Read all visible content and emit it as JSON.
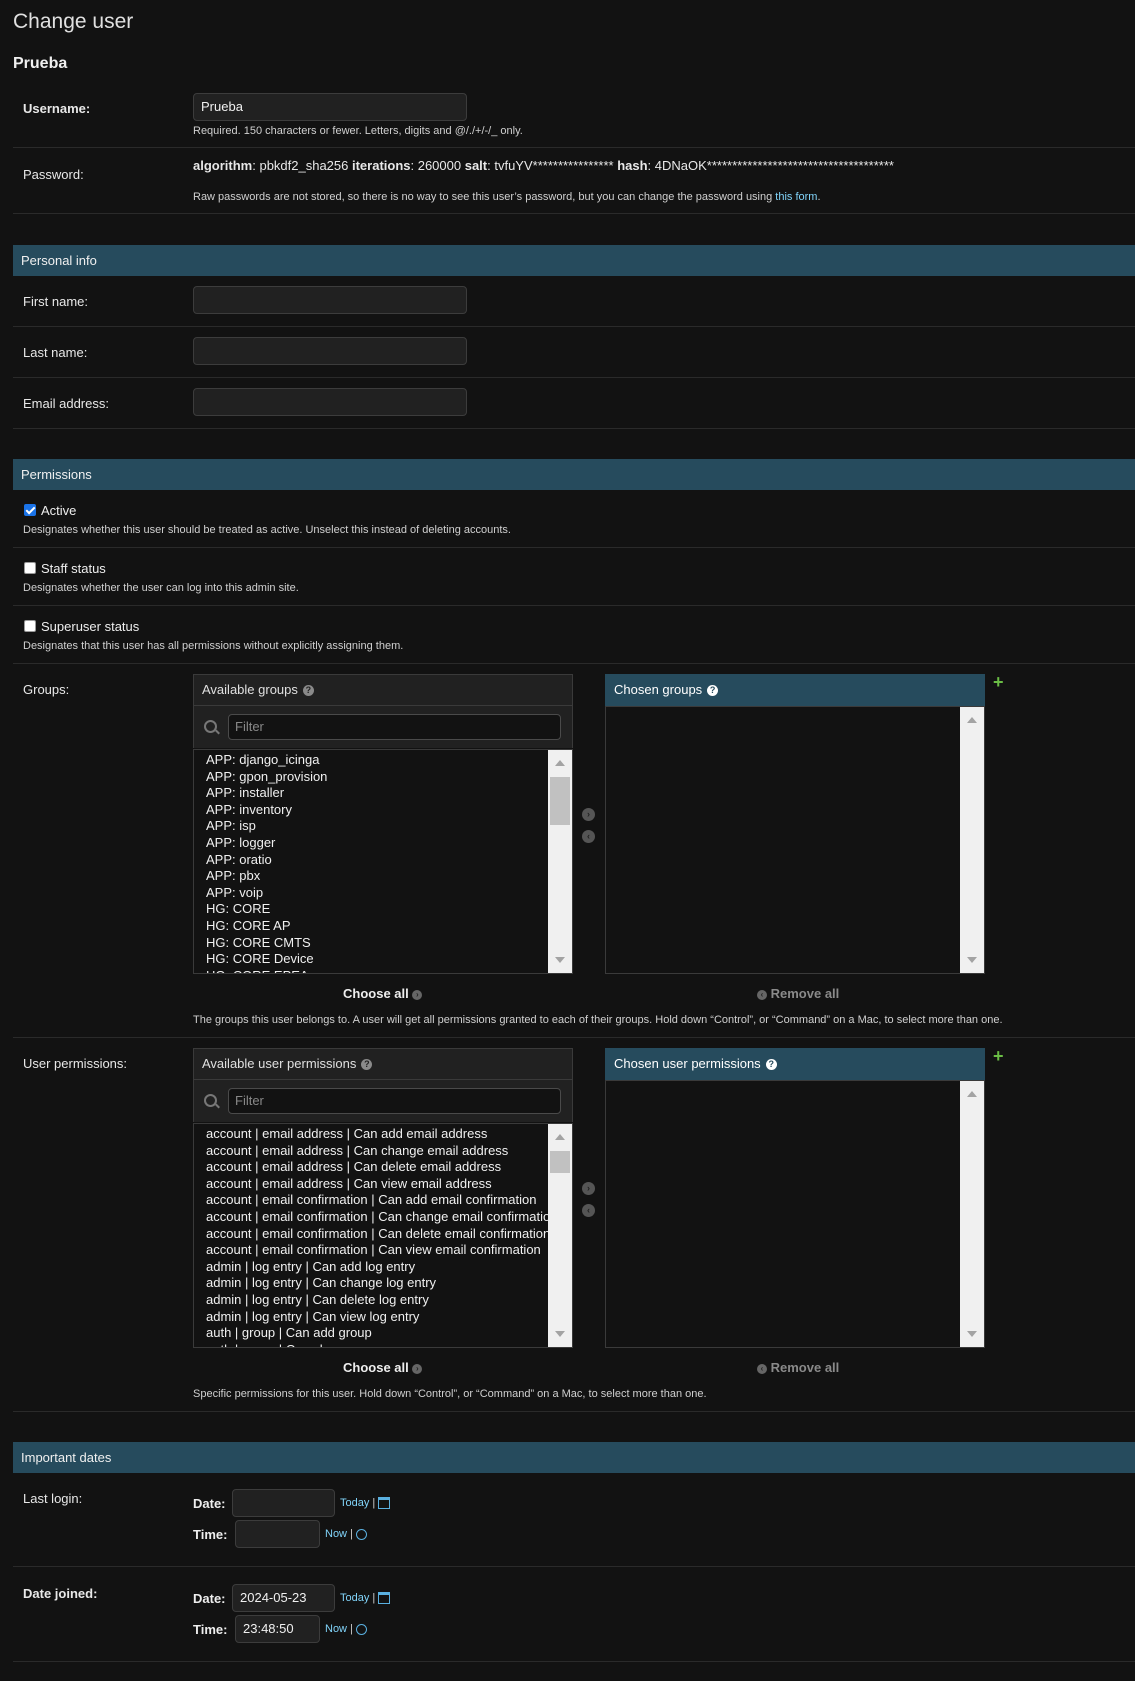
{
  "page": {
    "title": "Change user",
    "subtitle": "Prueba"
  },
  "username": {
    "label": "Username:",
    "value": "Prueba",
    "help": "Required. 150 characters or fewer. Letters, digits and @/./+/-/_ only."
  },
  "password": {
    "label": "Password:",
    "algorithm_label": "algorithm",
    "algorithm_value": ": pbkdf2_sha256 ",
    "iterations_label": "iterations",
    "iterations_value": ": 260000 ",
    "salt_label": "salt",
    "salt_value": ": tvfuYV**************** ",
    "hash_label": "hash",
    "hash_value": ": 4DNaOK*************************************",
    "help_text": "Raw passwords are not stored, so there is no way to see this user’s password, but you can change the password using ",
    "help_link": "this form",
    "help_end": "."
  },
  "personal_info": {
    "heading": "Personal info",
    "first_name_label": "First name:",
    "last_name_label": "Last name:",
    "email_label": "Email address:"
  },
  "permissions": {
    "heading": "Permissions",
    "active_label": "Active",
    "active_help": "Designates whether this user should be treated as active. Unselect this instead of deleting accounts.",
    "staff_label": "Staff status",
    "staff_help": "Designates whether the user can log into this admin site.",
    "superuser_label": "Superuser status",
    "superuser_help": "Designates that this user has all permissions without explicitly assigning them."
  },
  "groups": {
    "label": "Groups:",
    "available_title": "Available groups",
    "chosen_title": "Chosen groups",
    "filter_placeholder": "Filter",
    "items": [
      "APP: django_icinga",
      "APP: gpon_provision",
      "APP: installer",
      "APP: inventory",
      "APP: isp",
      "APP: logger",
      "APP: oratio",
      "APP: pbx",
      "APP: voip",
      "HG: CORE",
      "HG: CORE AP",
      "HG: CORE CMTS",
      "HG: CORE Device",
      "HG: CORE EPEA"
    ],
    "choose_all": "Choose all",
    "remove_all": "Remove all",
    "help": "The groups this user belongs to. A user will get all permissions granted to each of their groups. Hold down “Control”, or “Command” on a Mac, to select more than one."
  },
  "user_permissions": {
    "label": "User permissions:",
    "available_title": "Available user permissions",
    "chosen_title": "Chosen user permissions",
    "filter_placeholder": "Filter",
    "items": [
      "account | email address | Can add email address",
      "account | email address | Can change email address",
      "account | email address | Can delete email address",
      "account | email address | Can view email address",
      "account | email confirmation | Can add email confirmation",
      "account | email confirmation | Can change email confirmation",
      "account | email confirmation | Can delete email confirmation",
      "account | email confirmation | Can view email confirmation",
      "admin | log entry | Can add log entry",
      "admin | log entry | Can change log entry",
      "admin | log entry | Can delete log entry",
      "admin | log entry | Can view log entry",
      "auth | group | Can add group",
      "auth | group | Can change group"
    ],
    "choose_all": "Choose all",
    "remove_all": "Remove all",
    "help": "Specific permissions for this user. Hold down “Control”, or “Command” on a Mac, to select more than one."
  },
  "important_dates": {
    "heading": "Important dates",
    "last_login_label": "Last login:",
    "date_joined_label": "Date joined:",
    "date_label": "Date:",
    "time_label": "Time:",
    "today": "Today",
    "now": "Now",
    "sep": " |",
    "last_login_date": "",
    "last_login_time": "",
    "joined_date": "2024-05-23",
    "joined_time": "23:48:50"
  },
  "colors": {
    "section_bar": "#264b5d",
    "link": "#81d4fa",
    "plus": "#6abd45",
    "background": "#121212"
  }
}
